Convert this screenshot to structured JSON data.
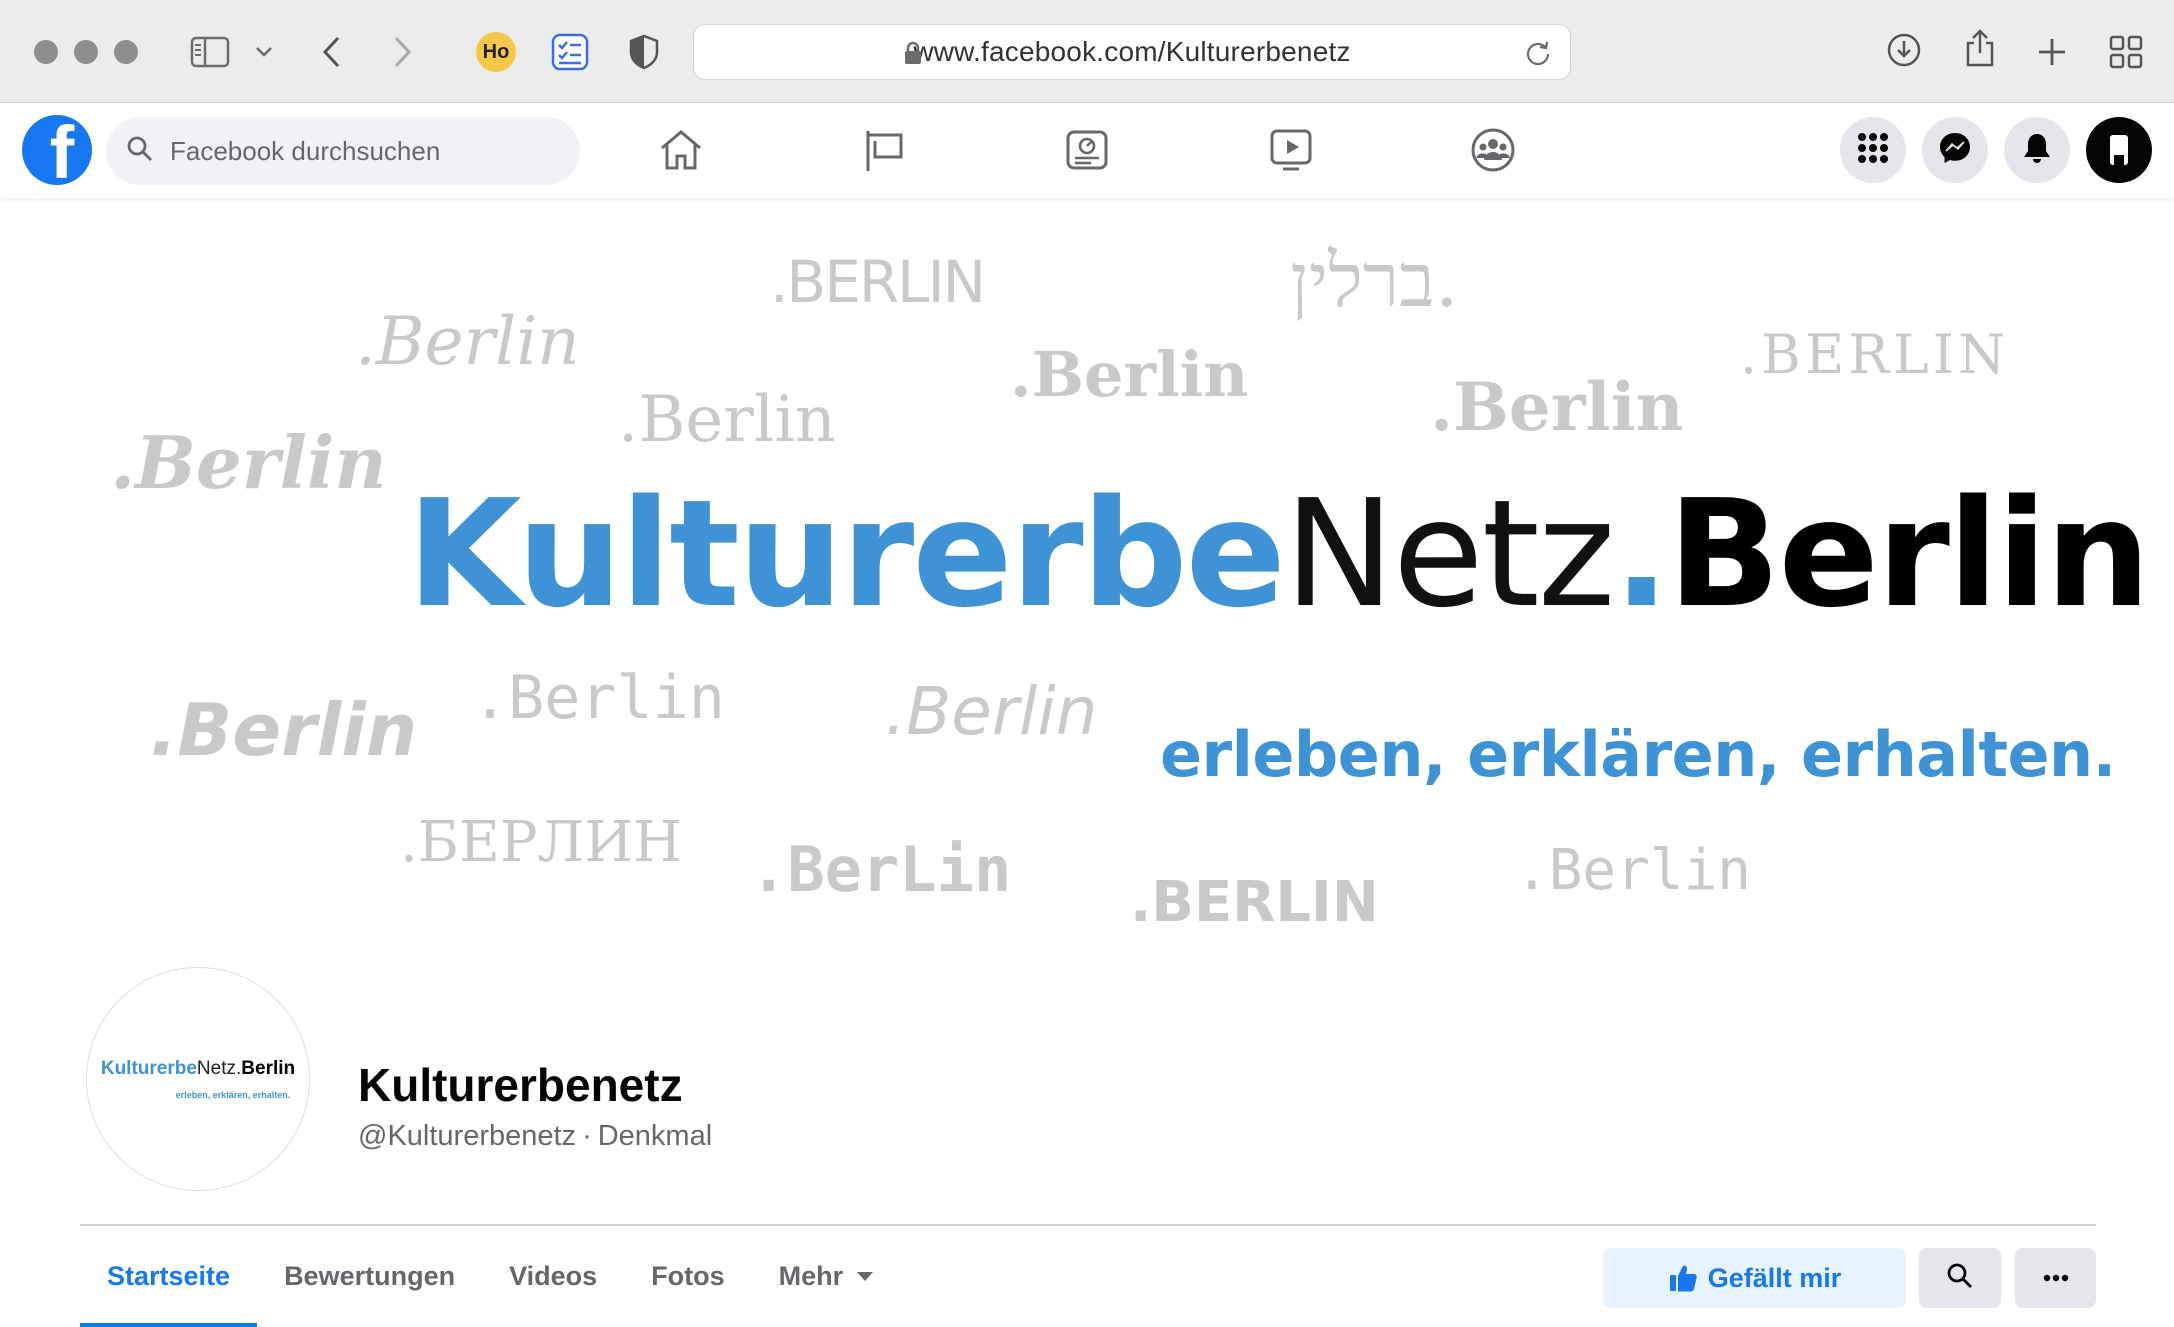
{
  "browser": {
    "url": "www.facebook.com/Kulturerbenetz",
    "extension_badge": "Ho"
  },
  "facebook": {
    "search_placeholder": "Facebook durchsuchen",
    "brand_color": "#1877f2"
  },
  "cover": {
    "title_part1": "Kulturerbe",
    "title_part2": "Netz",
    "title_dot": ".",
    "title_part3": "Berlin",
    "tagline": "erleben, erklären, erhalten.",
    "accent_color": "#3e93d6",
    "ghost_words": [
      ".BERLIN",
      "ברלין.",
      ".Berlin",
      ".Berlin",
      ".Berlin",
      ".Berlin",
      ".BERLIN",
      ".Berlin",
      ".Berlin",
      ".Berlin",
      ".Berlin",
      ".БЕРЛИН",
      ".BerLin",
      ".BERLIN",
      ".Berlin"
    ]
  },
  "page": {
    "name": "Kulturerbenetz",
    "handle": "@Kulturerbenetz",
    "separator": "·",
    "category": "Denkmal",
    "avatar_part1": "Kulturerbe",
    "avatar_part2": "Netz.",
    "avatar_part3": "Berlin",
    "avatar_tagline": "erleben, erklären, erhalten."
  },
  "tabs": [
    {
      "label": "Startseite",
      "active": true
    },
    {
      "label": "Bewertungen"
    },
    {
      "label": "Videos"
    },
    {
      "label": "Fotos"
    },
    {
      "label": "Mehr"
    }
  ],
  "actions": {
    "like_label": "Gefällt mir"
  }
}
